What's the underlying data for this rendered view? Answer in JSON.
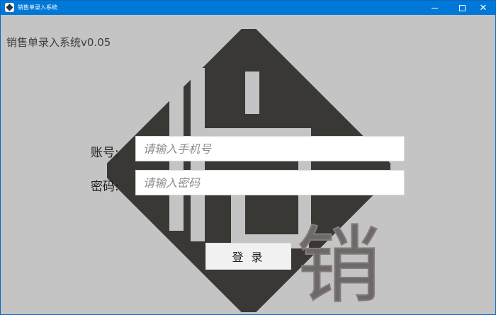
{
  "window": {
    "title": "销售单录入系统",
    "close_glyph": "✕"
  },
  "app": {
    "title": "销售单录入系统v0.05",
    "logo_char": "销"
  },
  "form": {
    "account_label": "账号:",
    "account_placeholder": "请输入手机号",
    "account_value": "",
    "password_label": "密码:",
    "password_placeholder": "请输入密码",
    "password_value": "",
    "login_label": "登 录"
  },
  "colors": {
    "titlebar": "#0078d7",
    "background": "#c4c4c4",
    "logo_dark": "#3a3835",
    "logo_char": "#6a6a6a"
  },
  "icons": {
    "app": "app-logo-icon",
    "minimize": "minimize-icon",
    "maximize": "maximize-icon",
    "close": "close-icon"
  }
}
